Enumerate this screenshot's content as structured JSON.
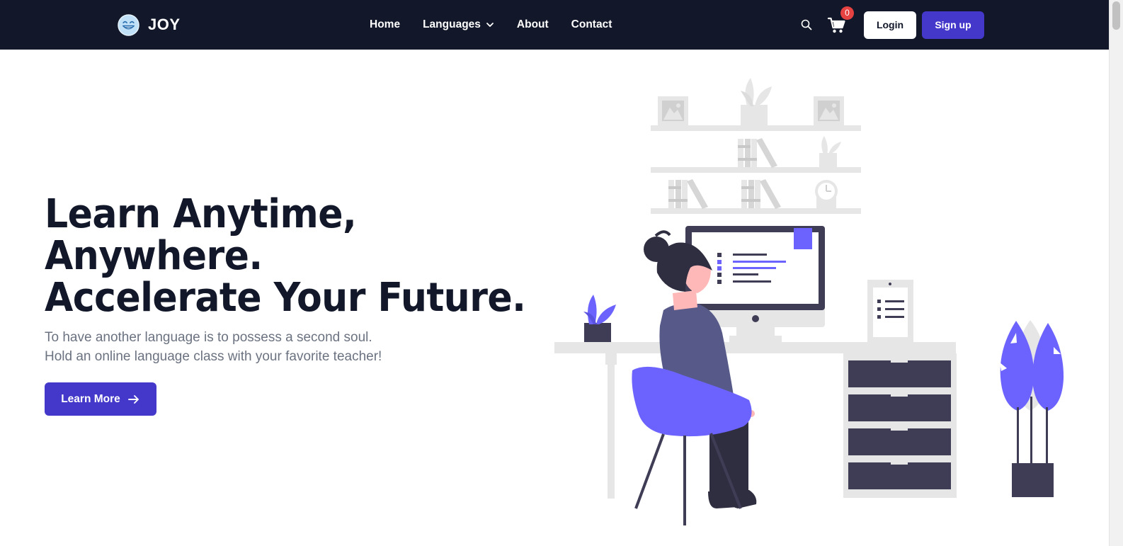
{
  "brand": {
    "name": "JOY",
    "logo_icon": "smiling-face-icon"
  },
  "nav": {
    "home": "Home",
    "languages": "Languages",
    "about": "About",
    "contact": "Contact"
  },
  "header_actions": {
    "search_icon": "search-icon",
    "cart_icon": "cart-icon",
    "cart_count": "0",
    "login_label": "Login",
    "signup_label": "Sign up"
  },
  "hero": {
    "title_lines": [
      "Learn Anytime,",
      "Anywhere.",
      "Accelerate Your Future."
    ],
    "subtitle_lines": [
      "To have another language is to possess a second soul.",
      "Hold an online language class with your favorite teacher!"
    ],
    "cta_label": "Learn More",
    "cta_icon": "arrow-right-icon"
  },
  "illustration": {
    "subject": "person-at-desk-illustration"
  },
  "colors": {
    "navbar_bg": "#121829",
    "primary": "#4338ca",
    "accent_purple": "#6c63ff",
    "dark_navy": "#3f3d56",
    "light_gray": "#e6e6e6",
    "badge_red": "#e74242",
    "text_dark": "#121829",
    "text_muted": "#6b7280"
  }
}
